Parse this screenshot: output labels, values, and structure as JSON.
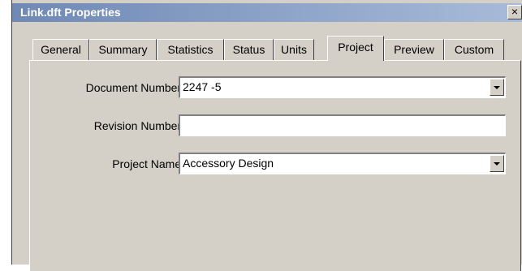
{
  "window": {
    "title": "Link.dft Properties",
    "close_label": "×"
  },
  "tabs": [
    {
      "label": "General"
    },
    {
      "label": "Summary"
    },
    {
      "label": "Statistics"
    },
    {
      "label": "Status"
    },
    {
      "label": "Units"
    },
    {
      "label": "Project",
      "active": true
    },
    {
      "label": "Preview"
    },
    {
      "label": "Custom"
    }
  ],
  "form": {
    "document_number": {
      "label": "Document Number:",
      "value": "2247 -5"
    },
    "revision_number": {
      "label": "Revision Number:",
      "value": ""
    },
    "project_name": {
      "label": "Project Name:",
      "value": "Accessory Design"
    }
  }
}
